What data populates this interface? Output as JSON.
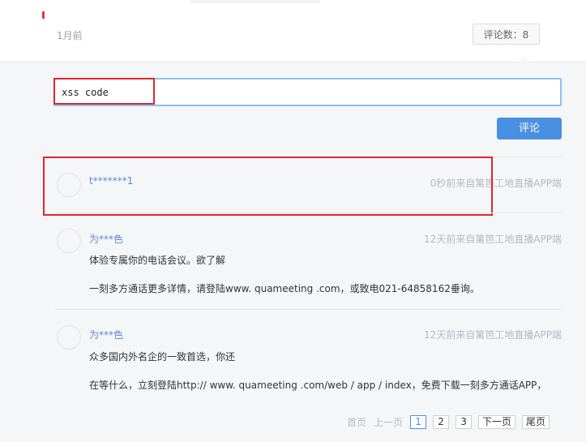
{
  "post": {
    "time_ago": "1月前",
    "comment_count_label": "评论数：8"
  },
  "composer": {
    "input_value": "xss code",
    "submit_label": "评论"
  },
  "comments": [
    {
      "user": "t*******1",
      "meta": "0秒前来自篱笆工地直播APP端",
      "lines": []
    },
    {
      "user": "为***色",
      "meta": "12天前来自篱笆工地直播APP端",
      "lines": [
        "体验专属你的电话会议。欲了解",
        "一刻多方通话更多详情，请登陆www. quameeting .com，或致电021-64858162垂询。"
      ]
    },
    {
      "user": "为***色",
      "meta": "12天前来自篱笆工地直播APP端",
      "lines": [
        "众多国内外名企的一致首选，你还",
        "在等什么，立刻登陆http:// www. quameeting .com/web / app / index，免费下载一刻多方通话APP，"
      ]
    }
  ],
  "pagination": {
    "first": "首页",
    "prev": "上一页",
    "pages": [
      "1",
      "2",
      "3"
    ],
    "current": "1",
    "next": "下一页",
    "last": "尾页"
  },
  "colors": {
    "accent": "#4a90e2",
    "highlight_box": "#e0262e",
    "username": "#5b8bd0"
  }
}
